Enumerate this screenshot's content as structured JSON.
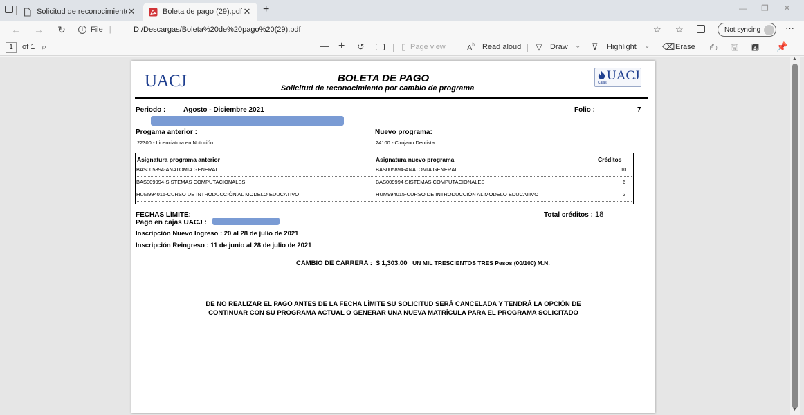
{
  "browser": {
    "tabs": [
      {
        "label": "Solicitud de reconocimiento",
        "active": false
      },
      {
        "label": "Boleta de pago (29).pdf",
        "active": true
      }
    ],
    "address": {
      "info_label": "File",
      "url": "D:/Descargas/Boleta%20de%20pago%20(29).pdf"
    },
    "sync_label": "Not syncing"
  },
  "pdf_toolbar": {
    "page_number": "1",
    "page_total": "of 1",
    "page_view": "Page view",
    "read_aloud": "Read aloud",
    "draw": "Draw",
    "highlight": "Highlight",
    "erase": "Erase"
  },
  "document": {
    "logo_left": "UACJ",
    "logo_right": "UACJ",
    "logo_right_sub": "Cajas",
    "title": "BOLETA DE PAGO",
    "subtitle": "Solicitud de reconocimiento por cambio de programa",
    "periodo_label": "Periodo :",
    "periodo_value": "Agosto - Diciembre 2021",
    "folio_label": "Folio :",
    "folio_value": "7",
    "prog_anterior_label": "Progama anterior :",
    "prog_anterior_value": "22300 - Licenciatura en Nutrición",
    "nuevo_prog_label": "Nuevo programa:",
    "nuevo_prog_value": "24100 - Cirujano Dentista",
    "table": {
      "headers": [
        "Asignatura programa anterior",
        "Asignatura nuevo programa",
        "Créditos"
      ],
      "rows": [
        [
          "BAS005894-ANATOMIA GENERAL",
          "BAS005894-ANATOMIA GENERAL",
          "10"
        ],
        [
          "BAS009994-SISTEMAS COMPUTACIONALES",
          "BAS009994-SISTEMAS COMPUTACIONALES",
          "6"
        ],
        [
          "HUM994015-CURSO DE INTRODUCCIÓN AL MODELO EDUCATIVO",
          "HUM994015-CURSO DE INTRODUCCIÓN AL MODELO EDUCATIVO",
          "2"
        ]
      ]
    },
    "fechas_label": "FECHAS LÍMITE:",
    "pago_cajas_label": "Pago en cajas UACJ :",
    "total_creditos_label": "Total créditos :",
    "total_creditos_value": "18",
    "inscripcion_nuevo": "Inscripción Nuevo Ingreso : 20 al 28 de julio de 2021",
    "inscripcion_reingreso": "Inscripción Reingreso : 11 de junio al 28 de julio de 2021",
    "cambio_label": "CAMBIO DE CARRERA :",
    "cambio_amount": "$ 1,303.00",
    "cambio_words": "UN  MIL TRESCIENTOS TRES Pesos (00/100) M.N.",
    "aviso_line1": "DE NO REALIZAR EL PAGO ANTES DE LA FECHA LÍMITE SU SOLICITUD SERÁ CANCELADA Y TENDRÁ LA OPCIÓN DE",
    "aviso_line2": "CONTINUAR CON SU PROGRAMA ACTUAL O GENERAR UNA NUEVA MATRÍCULA PARA EL PROGRAMA SOLICITADO"
  }
}
